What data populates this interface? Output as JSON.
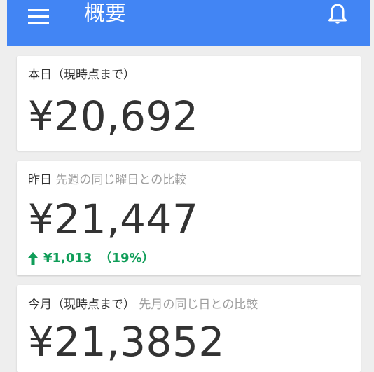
{
  "app_bar": {
    "title": "概要",
    "color": "#4285f4",
    "menu_icon": "hamburger-menu-icon",
    "notification_icon": "bell-icon"
  },
  "cards": [
    {
      "label": "本日（現時点まで）",
      "sub_label": "",
      "amount": "¥20,692"
    },
    {
      "label": "昨日",
      "sub_label": "先週の同じ曜日との比較",
      "amount": "¥21,447",
      "change_amount": "¥1,013",
      "change_percent": "（19%）",
      "change_direction": "up",
      "change_color": "#0f9d58"
    },
    {
      "label": "今月（現時点まで）",
      "sub_label": "先月の同じ日との比較",
      "amount": "¥21,3852"
    }
  ]
}
